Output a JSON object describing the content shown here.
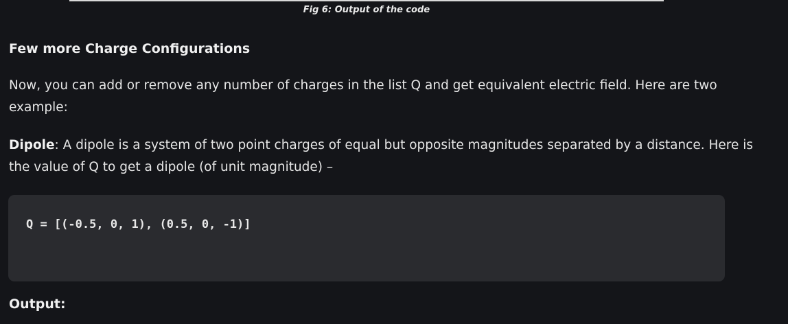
{
  "figure": {
    "caption": "Fig 6: Output of the code"
  },
  "section": {
    "heading": "Few more Charge Configurations",
    "paragraph_1": "Now, you can add or remove any number of charges in the list Q and get equivalent electric field. Here are two example:",
    "dipole_term": "Dipole",
    "dipole_text": ": A dipole is a system of two point charges of equal but opposite magnitudes separated by a distance. Here is the value of Q to get a dipole (of unit magnitude) –"
  },
  "code": {
    "line_1": "Q = [(-0.5, 0, 1), (0.5, 0, -1)]"
  },
  "output": {
    "heading": "Output:"
  }
}
